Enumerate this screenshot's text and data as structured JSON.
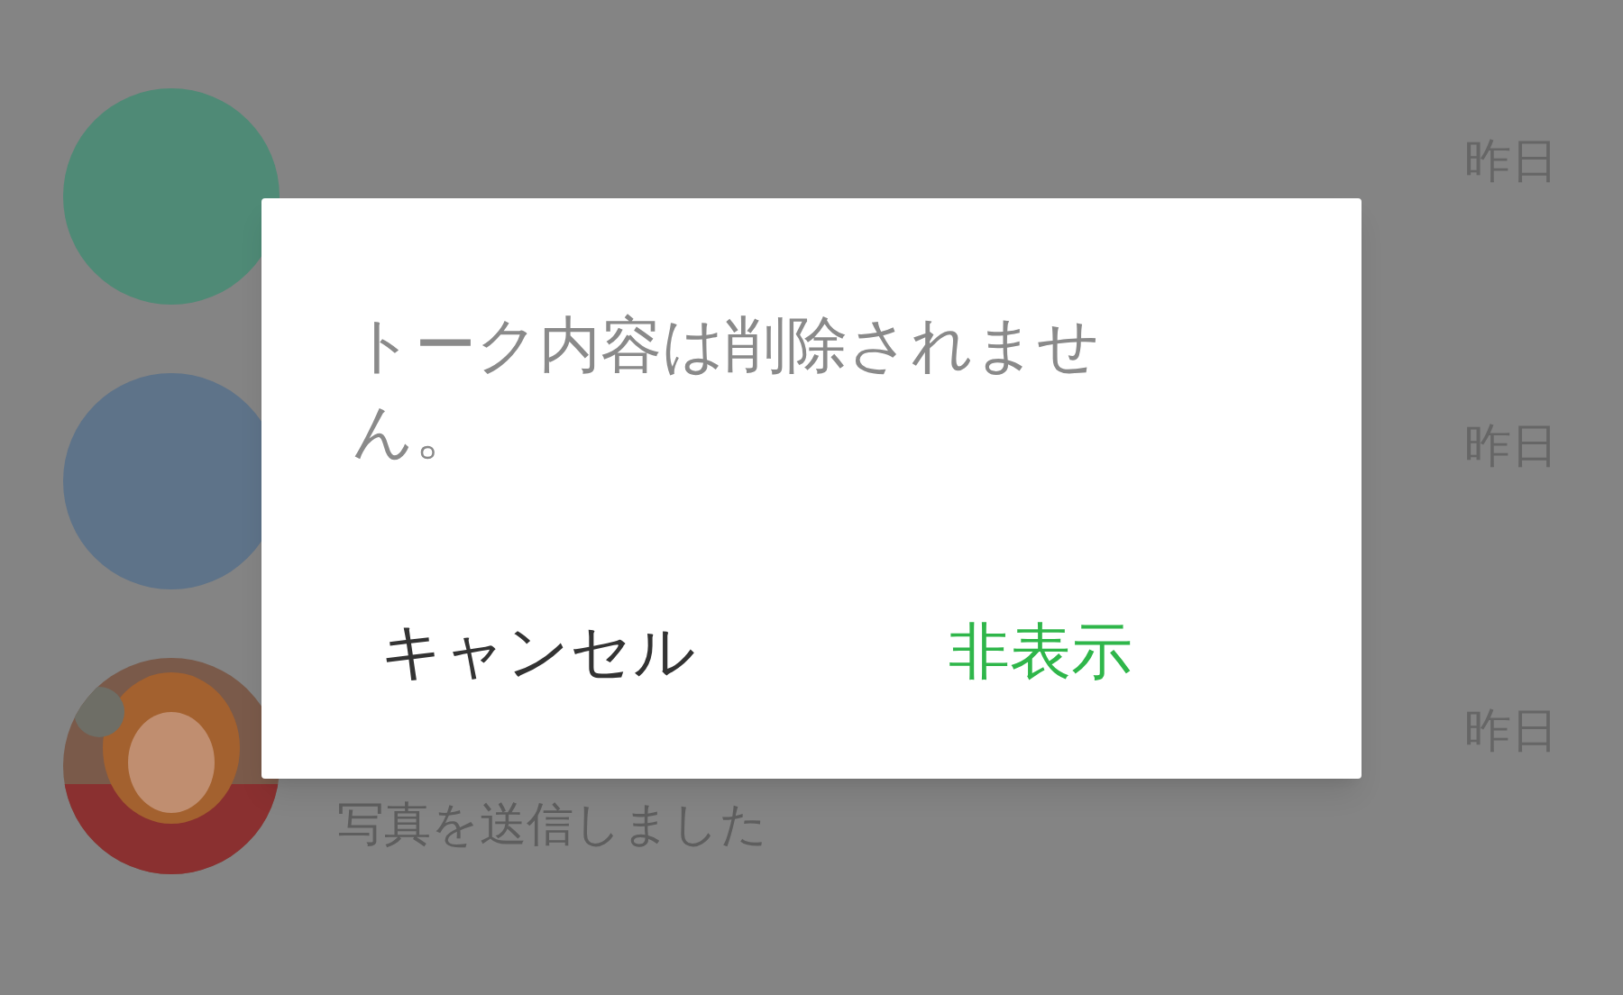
{
  "chat_list": [
    {
      "avatar": {
        "kind": "color",
        "color": "#4f8a76"
      },
      "time": "昨日"
    },
    {
      "avatar": {
        "kind": "color",
        "color": "#5e7389"
      },
      "time": "昨日"
    },
    {
      "time": "昨日",
      "preview": "写真を送信しました"
    }
  ],
  "dialog": {
    "message": "トーク内容は削除されません。",
    "buttons": [
      {
        "label": "キャンセル",
        "kind": "neutral"
      },
      {
        "label": "非表示",
        "kind": "accent"
      }
    ]
  }
}
